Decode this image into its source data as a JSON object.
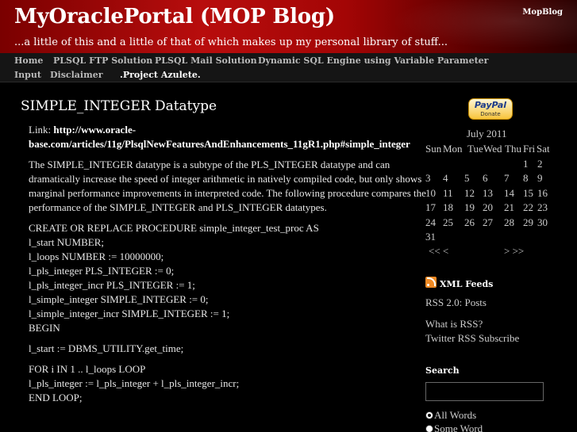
{
  "header": {
    "title": "MyOraclePortal (MOP Blog)",
    "tagline": "...a little of this and a little of that of which makes up my personal library of stuff...",
    "corner_link": "MopBlog"
  },
  "nav": {
    "items": [
      {
        "label": "Home"
      },
      {
        "label": "PLSQL FTP Solution"
      },
      {
        "label": "PLSQL Mail Solution"
      },
      {
        "label": "Dynamic SQL Engine using Variable Parameter"
      },
      {
        "label": "Input"
      },
      {
        "label": "Disclaimer"
      },
      {
        "label": ".Project Azulete."
      }
    ]
  },
  "post": {
    "title": "SIMPLE_INTEGER Datatype",
    "link_prefix": "Link: ",
    "link_text_1": "http://www.oracle-",
    "link_text_2": "base.com/articles/11g/PlsqlNewFeaturesAndEnhancements_11gR1.php#simple_integer",
    "intro": "The SIMPLE_INTEGER datatype is a subtype of the PLS_INTEGER datatype and can dramatically increase the speed of integer arithmetic in natively compiled code, but only shows marginal performance improvements in interpreted code. The following procedure compares the performance of the SIMPLE_INTEGER and PLS_INTEGER datatypes.",
    "code_block_1": [
      "CREATE OR REPLACE PROCEDURE simple_integer_test_proc AS",
      "l_start NUMBER;",
      "l_loops NUMBER := 10000000;",
      "l_pls_integer PLS_INTEGER := 0;",
      "l_pls_integer_incr PLS_INTEGER := 1;",
      "l_simple_integer SIMPLE_INTEGER := 0;",
      "l_simple_integer_incr SIMPLE_INTEGER := 1;",
      "BEGIN"
    ],
    "code_block_2": [
      "l_start := DBMS_UTILITY.get_time;"
    ],
    "code_block_3": [
      "FOR i IN 1 .. l_loops LOOP",
      "l_pls_integer := l_pls_integer + l_pls_integer_incr;",
      "END LOOP;"
    ]
  },
  "sidebar": {
    "paypal_word": "PayPal",
    "paypal_donate": "Donate",
    "calendar": {
      "caption": "July 2011",
      "weekdays": [
        "Sun",
        "Mon",
        "Tue",
        "Wed",
        "Thu",
        "Fri",
        "Sat"
      ],
      "weeks": [
        [
          "",
          "",
          "",
          "",
          "",
          "1",
          "2"
        ],
        [
          "3",
          "4",
          "5",
          "6",
          "7",
          "8",
          "9"
        ],
        [
          "10",
          "11",
          "12",
          "13",
          "14",
          "15",
          "16"
        ],
        [
          "17",
          "18",
          "19",
          "20",
          "21",
          "22",
          "23"
        ],
        [
          "24",
          "25",
          "26",
          "27",
          "28",
          "29",
          "30"
        ],
        [
          "31",
          "",
          "",
          "",
          "",
          "",
          ""
        ]
      ],
      "prev": "<< <",
      "next": "> >>"
    },
    "feeds": {
      "heading": "XML Feeds",
      "rss": "RSS 2.0: Posts",
      "what_is_rss": "What is RSS?",
      "twitter": "Twitter RSS Subscribe"
    },
    "search": {
      "heading": "Search",
      "input_value": "",
      "option_all": "All Words",
      "option_some": "Some Word"
    }
  }
}
